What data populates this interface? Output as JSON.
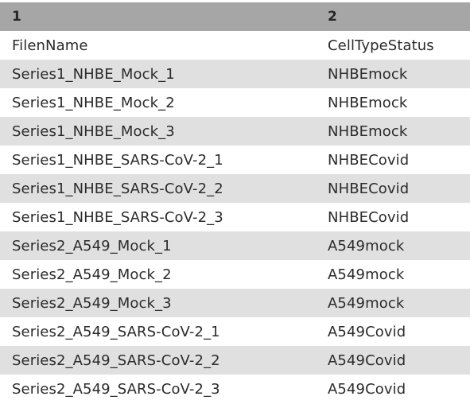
{
  "table": {
    "header": [
      "1",
      "2"
    ],
    "rows": [
      [
        "FilenName",
        "CellTypeStatus"
      ],
      [
        "Series1_NHBE_Mock_1",
        "NHBEmock"
      ],
      [
        "Series1_NHBE_Mock_2",
        "NHBEmock"
      ],
      [
        "Series1_NHBE_Mock_3",
        "NHBEmock"
      ],
      [
        "Series1_NHBE_SARS-CoV-2_1",
        "NHBECovid"
      ],
      [
        "Series1_NHBE_SARS-CoV-2_2",
        "NHBECovid"
      ],
      [
        "Series1_NHBE_SARS-CoV-2_3",
        "NHBECovid"
      ],
      [
        "Series2_A549_Mock_1",
        "A549mock"
      ],
      [
        "Series2_A549_Mock_2",
        "A549mock"
      ],
      [
        "Series2_A549_Mock_3",
        "A549mock"
      ],
      [
        "Series2_A549_SARS-CoV-2_1",
        "A549Covid"
      ],
      [
        "Series2_A549_SARS-CoV-2_2",
        "A549Covid"
      ],
      [
        "Series2_A549_SARS-CoV-2_3",
        "A549Covid"
      ]
    ]
  },
  "colors": {
    "header_bg": "#a6a6a6",
    "stripe_bg": "#e0e0e0",
    "row_bg": "#ffffff"
  }
}
